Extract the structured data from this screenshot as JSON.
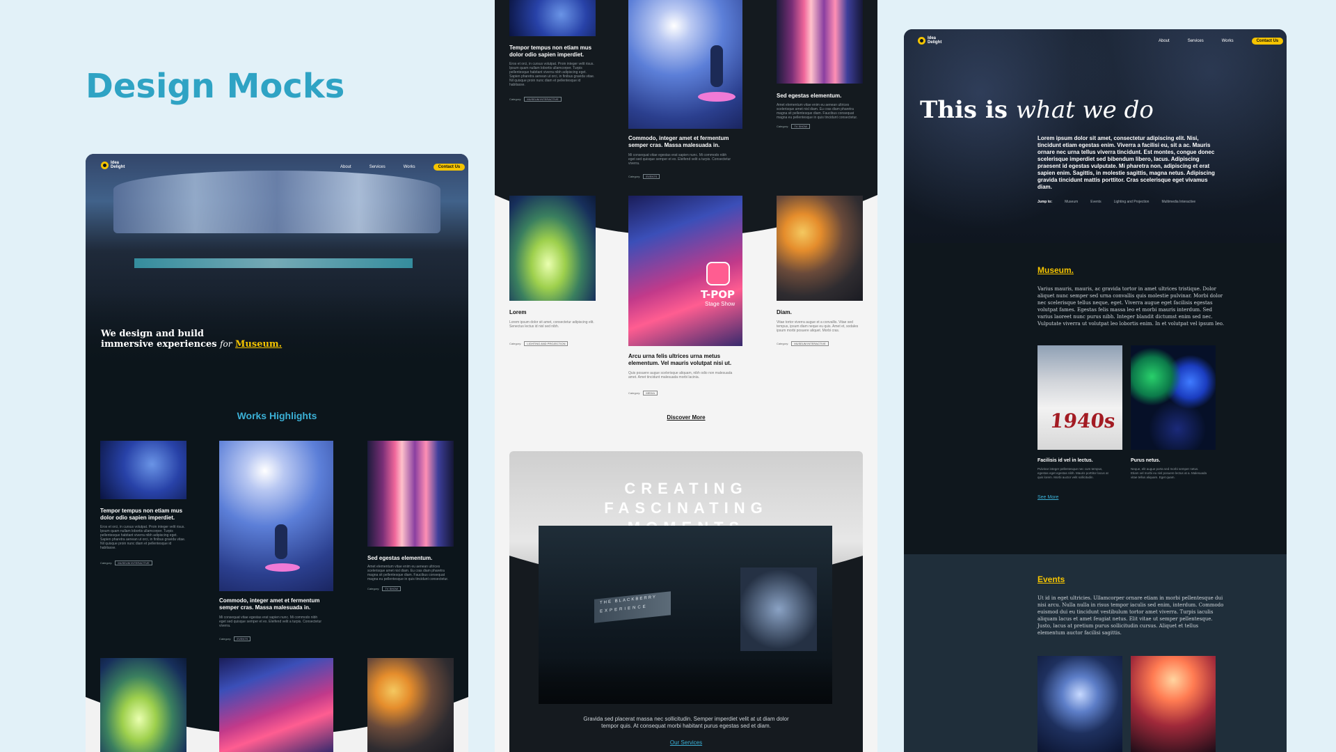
{
  "page_title": "Design Mocks",
  "brand": {
    "logo_text_1": "Idea",
    "logo_text_2": "Delight",
    "accent": "#f5c400",
    "title_color": "#2fa3c4"
  },
  "nav": {
    "about": "About",
    "services": "Services",
    "works": "Works",
    "contact": "Contact Us"
  },
  "mock1": {
    "hero_line1": "We design and build",
    "hero_line2": "immersive experiences",
    "hero_for": "for",
    "hero_highlight": "Museum.",
    "section_title": "Works Highlights",
    "cards": [
      {
        "title": "Tempor tempus non etiam mus dolor odio sapien imperdiet.",
        "body": "Eros et orci, in cursus volutpat. Proin integer velit risus. Ipsum quam nullam lobortis ullamcorper. Turpis pellentesque habitant viverra nibh adipiscing eget. Sapien pharetra aenean ut orci, in finibus gravida vitae. Nil quisque proin nunc diam et pellentesque id habitasse.",
        "category_label": "Category:",
        "category": "MUSEUM INTERACTIVE"
      },
      {
        "title": "Commodo, integer amet et fermentum semper cras. Massa malesuada in.",
        "body": "Mi consequat vitae egestas erat sapien nunc. Mi commodo nibh eget sed quisque semper et ex. Eleifend velit a turpis. Consectetur viverra.",
        "category_label": "Category:",
        "category": "EVENTS"
      },
      {
        "title": "Sed egestas elementum.",
        "body": "Amet elementum vitae enim eu aenean ultrices scelerisque amet nisl diam. Eu cras diam pharetra magna sit pellentesque diam. Faucibus consequat magna eu pellentesque in quis tincidunt consectetur.",
        "category_label": "Category:",
        "category": "TV SHOW"
      }
    ]
  },
  "mock2": {
    "cards_top": [
      {
        "title": "Tempor tempus non etiam mus dolor odio sapien imperdiet.",
        "body": "Eros et orci, in cursus volutpat. Proin integer velit risus. Ipsum quam nullam lobortis ullamcorper. Turpis pellentesque habitant viverra nibh adipiscing eget. Sapien pharetra aenean ut orci, in finibus gravida vitae. Nil quisque proin nunc diam et pellentesque id habitasse.",
        "category_label": "Category:",
        "category": "MUSEUM INTERACTIVE"
      },
      {
        "title": "Commodo, integer amet et fermentum semper cras. Massa malesuada in.",
        "body": "Mi consequat vitae egestas erat sapien nunc. Mi commodo nibh eget sed quisque semper et ex. Eleifend velit a turpis. Consectetur viverra.",
        "category_label": "Category:",
        "category": "EVENTS"
      },
      {
        "title": "Sed egestas elementum.",
        "body": "Amet elementum vitae enim eu aenean ultrices scelerisque amet nisl diam. Eu cras diam pharetra magna sit pellentesque diam. Faucibus consequat magna eu pellentesque in quis tincidunt consectetur.",
        "category_label": "Category:",
        "category": "TV SHOW"
      }
    ],
    "cards_bottom": [
      {
        "title": "Lorem",
        "body": "Lorem ipsum dolor sit amet, consectetur adipiscing elit. Senectus lectus id nisl sed nibh.",
        "category_label": "Category:",
        "category": "LIGHTING AND PROJECTION"
      },
      {
        "title": "Arcu urna felis ultrices urna metus elementum. Vel mauris volutpat nisi ut.",
        "body": "Quis posuere augue scelerisque aliquam, nibh odio non malesuada amet. Amet tincidunt malesuada morbi lacinia.",
        "category_label": "Category:",
        "category": "MEDIA"
      },
      {
        "title": "Diam.",
        "body": "Vitae tortor viverra augue et a convallis. Vitae sed tempus, ipsum diam neque eu quis. Amet et, sodales ipsum morbi posuere aliquet. Morbi cras.",
        "category_label": "Category:",
        "category": "MUSEUM INTERACTIVE"
      }
    ],
    "tpop_text_1": "T-POP",
    "tpop_text_2": "Stage Show",
    "discover_more": "Discover More",
    "banner_line1": "CREATING",
    "banner_line2": "FASCINATING",
    "banner_line3": "MOMENTS",
    "stage_sign_1": "THE BLACKBERRY",
    "stage_sign_2": "EXPERIENCE",
    "banner_caption": "Gravida sed placerat massa nec sollicitudin. Semper imperdiet velit at ut diam dolor tempor quis. At consequat morbi habitant purus egestas sed et diam.",
    "our_services": "Our Services"
  },
  "mock3": {
    "hero_title_plain": "This is",
    "hero_title_italic": "what we do",
    "hero_body": "Lorem ipsum dolor sit amet, consectetur adipiscing elit. Nisi, tincidunt etiam egestas enim. Viverra a facilisi eu, sit a ac. Mauris ornare nec urna tellus viverra tincidunt. Est montes, congue donec scelerisque imperdiet sed bibendum libero, lacus. Adipiscing praesent id egestas vulputate. Mi pharetra non, adipiscing et erat sapien enim. Sagittis, in molestie sagittis, magna netus. Adipiscing gravida tincidunt mattis porttitor. Cras scelerisque eget vivamus diam.",
    "jump_label": "Jump to:",
    "jump_links": [
      "Museum",
      "Events",
      "Lighting and Projection",
      "Multimedia Interactive"
    ],
    "museum_title": "Museum.",
    "museum_body": "Varius mauris, mauris, ac gravida tortor in amet ultrices tristique. Dolor aliquet nunc semper sed urna convallis quis molestie pulvinar. Morbi dolor nec scelerisque tellus neque, eget. Viverra augue eget facilisis egestas volutpat fames. Egestas felis massa leo et morbi mauris interdum. Sed varius laoreet nunc purus nibh. Integer blandit dictumst enim sed nec. Vulputate viverra ut volutpat leo lobortis enim. In et volutpat vel ipsum leo.",
    "museum_cards": [
      {
        "title": "Facilisis id vel in lectus.",
        "body": "Pulvinar integer pellentesque nec cum tempus, egestas eget egestas nibh. Mauris porttitor lacus at quis lorem. Morbi auctor velit sollicitudin."
      },
      {
        "title": "Purus netus.",
        "body": "Neque, elit augue porta sed morbi semper netus. Etiam vel morbi eu nisl posuere lectus at a. Malesuada vitae tellus aliquam. Eget quam."
      }
    ],
    "img_1940_text": "1940s",
    "see_more": "See More",
    "events_title": "Events",
    "events_body": "Ut id in eget ultricies. Ullamcorper ornare etiam in morbi pellentesque dui nisi arcu. Nulla nulla in risus tempor iaculis sed enim, interdum. Commodo euismod dui eu tincidunt vestibulum tortor amet viverra. Turpis iaculis aliquam lacus et amet feugiat netus. Elit vitae ut semper pellentesque. Justo, lacus at pretium purus sollicitudin cursus. Aliquet et tellus elementum auctor facilisi sagittis."
  }
}
